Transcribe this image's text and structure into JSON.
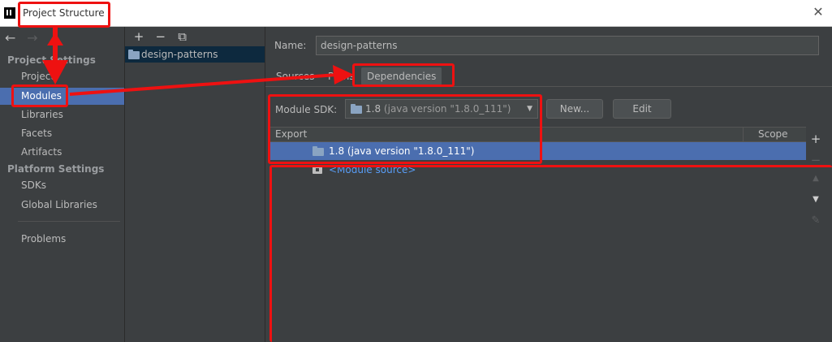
{
  "window": {
    "title": "Project Structure",
    "close_glyph": "✕",
    "icon": "intellij-logo-icon"
  },
  "left_nav": {
    "back_glyph": "←",
    "forward_glyph": "→",
    "project_settings_header": "Project Settings",
    "project_settings_items": [
      "Project",
      "Modules",
      "Libraries",
      "Facets",
      "Artifacts"
    ],
    "platform_settings_header": "Platform Settings",
    "platform_settings_items": [
      "SDKs",
      "Global Libraries"
    ],
    "problems_label": "Problems",
    "selected": "Modules"
  },
  "module_panel": {
    "add_glyph": "+",
    "remove_glyph": "−",
    "copy_glyph": "⧉",
    "module_name": "design-patterns"
  },
  "detail": {
    "name_label": "Name:",
    "name_value": "design-patterns",
    "tabs": [
      "Sources",
      "Paths",
      "Dependencies"
    ],
    "active_tab": "Dependencies",
    "sdk_label": "Module SDK:",
    "sdk_value": "1.8",
    "sdk_version_text": "(java version \"1.8.0_111\")",
    "new_button": "New...",
    "edit_button": "Edit",
    "table": {
      "col_export": "Export",
      "col_scope": "Scope",
      "rows": [
        {
          "version": "1.8",
          "text": "(java version \"1.8.0_111\")"
        },
        {
          "text": "<Module source>"
        }
      ]
    },
    "side_tools": {
      "add": "+",
      "remove": "−",
      "up": "▲",
      "down": "▼",
      "edit": "✎"
    }
  },
  "annotation_color": "#ee1111"
}
